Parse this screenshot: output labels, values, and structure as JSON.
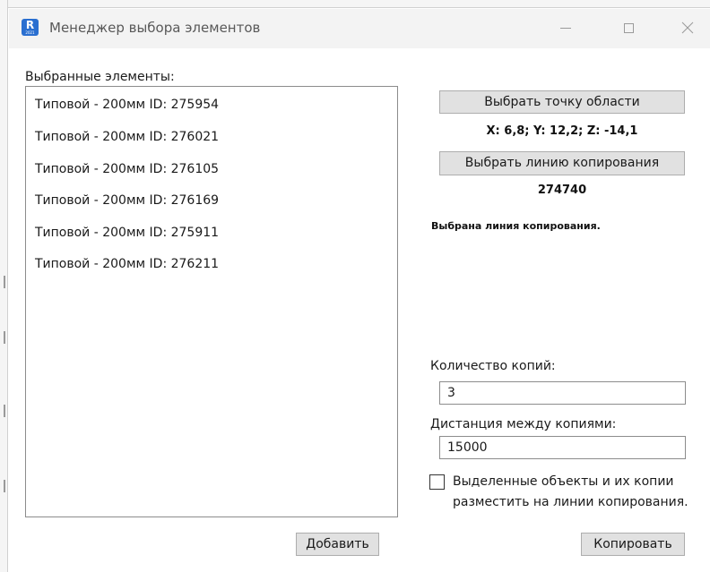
{
  "window": {
    "title": "Менеджер выбора элементов",
    "app_icon_letter": "R",
    "app_icon_sub": "2021",
    "accent_color": "#2a6fd0"
  },
  "selected": {
    "label": "Выбранные элементы:",
    "items": [
      "Типовой - 200мм ID: 275954",
      "Типовой - 200мм ID: 276021",
      "Типовой - 200мм ID: 276105",
      "Типовой - 200мм ID: 276169",
      "Типовой - 200мм ID: 275911",
      "Типовой - 200мм ID: 276211"
    ],
    "add_button": "Добавить"
  },
  "area": {
    "button": "Выбрать точку области",
    "coords": "X: 6,8; Y: 12,2; Z: -14,1"
  },
  "line": {
    "button": "Выбрать линию копирования",
    "id": "274740",
    "status": "Выбрана линия копирования."
  },
  "copies": {
    "count_label": "Количество копий:",
    "count_value": "3",
    "distance_label": "Дистанция между копиями:",
    "distance_value": "15000",
    "place_on_line_checked": false,
    "place_on_line_text_1": "Выделенные объекты и их копии",
    "place_on_line_text_2": "разместить на линии копирования.",
    "copy_button": "Копировать"
  }
}
